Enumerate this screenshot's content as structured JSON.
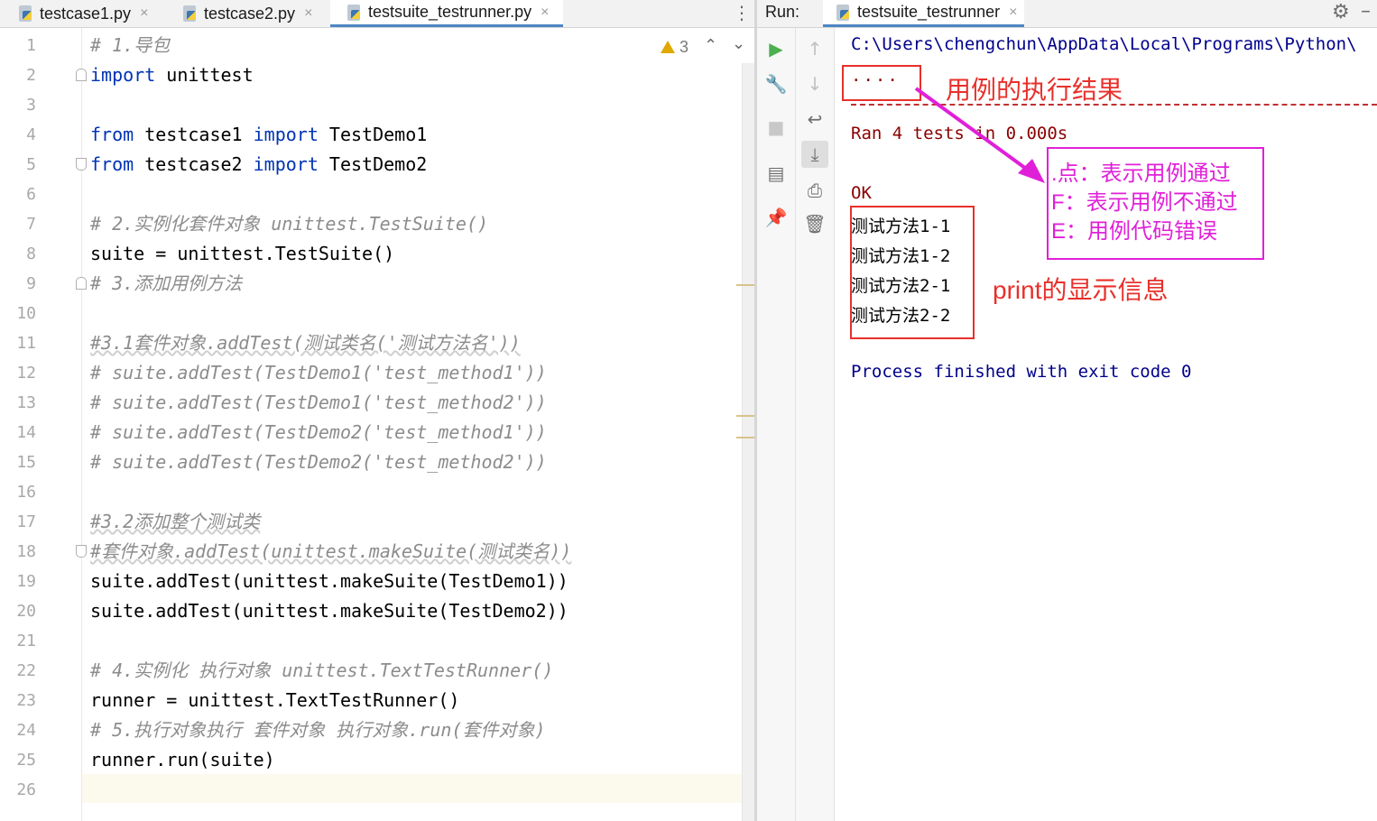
{
  "editor": {
    "tabs": [
      {
        "label": "testcase1.py",
        "close": "×"
      },
      {
        "label": "testcase2.py",
        "close": "×"
      },
      {
        "label": "testsuite_testrunner.py",
        "close": "×"
      }
    ],
    "tab_menu": "⋮",
    "inspection_count": "3",
    "line_numbers": [
      "1",
      "2",
      "3",
      "4",
      "5",
      "6",
      "7",
      "8",
      "9",
      "10",
      "11",
      "12",
      "13",
      "14",
      "15",
      "16",
      "17",
      "18",
      "19",
      "20",
      "21",
      "22",
      "23",
      "24",
      "25",
      "26"
    ],
    "lines": {
      "l1": "# 1.导包",
      "l2_kw": "import",
      "l2_rest": " unittest",
      "l4_kw1": "from",
      "l4_mid": " testcase1 ",
      "l4_kw2": "import",
      "l4_rest": " TestDemo1",
      "l5_kw1": "from",
      "l5_mid": " testcase2 ",
      "l5_kw2": "import",
      "l5_rest": " TestDemo2",
      "l7": "# 2.实例化套件对象 unittest.TestSuite()",
      "l8": "suite = unittest.TestSuite()",
      "l9": "# 3.添加用例方法",
      "l11": "#3.1套件对象.addTest(测试类名('测试方法名'))",
      "l12": "# suite.addTest(TestDemo1('test_method1'))",
      "l13": "# suite.addTest(TestDemo1('test_method2'))",
      "l14": "# suite.addTest(TestDemo2('test_method1'))",
      "l15": "# suite.addTest(TestDemo2('test_method2'))",
      "l17": "#3.2添加整个测试类",
      "l18": "#套件对象.addTest(unittest.makeSuite(测试类名))",
      "l19": "suite.addTest(unittest.makeSuite(TestDemo1))",
      "l20": "suite.addTest(unittest.makeSuite(TestDemo2))",
      "l22": "# 4.实例化 执行对象 unittest.TextTestRunner()",
      "l23": "runner = unittest.TextTestRunner()",
      "l24": "# 5.执行对象执行 套件对象 执行对象.run(套件对象)",
      "l25": "runner.run(suite)"
    }
  },
  "run": {
    "label": "Run:",
    "tab_label": "testsuite_testrunner",
    "tab_close": "×",
    "console": {
      "path": "C:\\Users\\chengchun\\AppData\\Local\\Programs\\Python\\",
      "dots": "....",
      "ran": "Ran 4 tests in 0.000s",
      "ok": "OK",
      "prints": [
        "测试方法1-1",
        "测试方法1-2",
        "测试方法2-1",
        "测试方法2-2"
      ],
      "process": "Process finished with exit code 0"
    }
  },
  "annotations": {
    "result_title": "用例的执行结果",
    "legend": [
      ".点：表示用例通过",
      "F：表示用例不通过",
      "E：用例代码错误"
    ],
    "print_title": "print的显示信息",
    "colors": {
      "red": "#e8302b",
      "magenta": "#e020d8"
    }
  }
}
